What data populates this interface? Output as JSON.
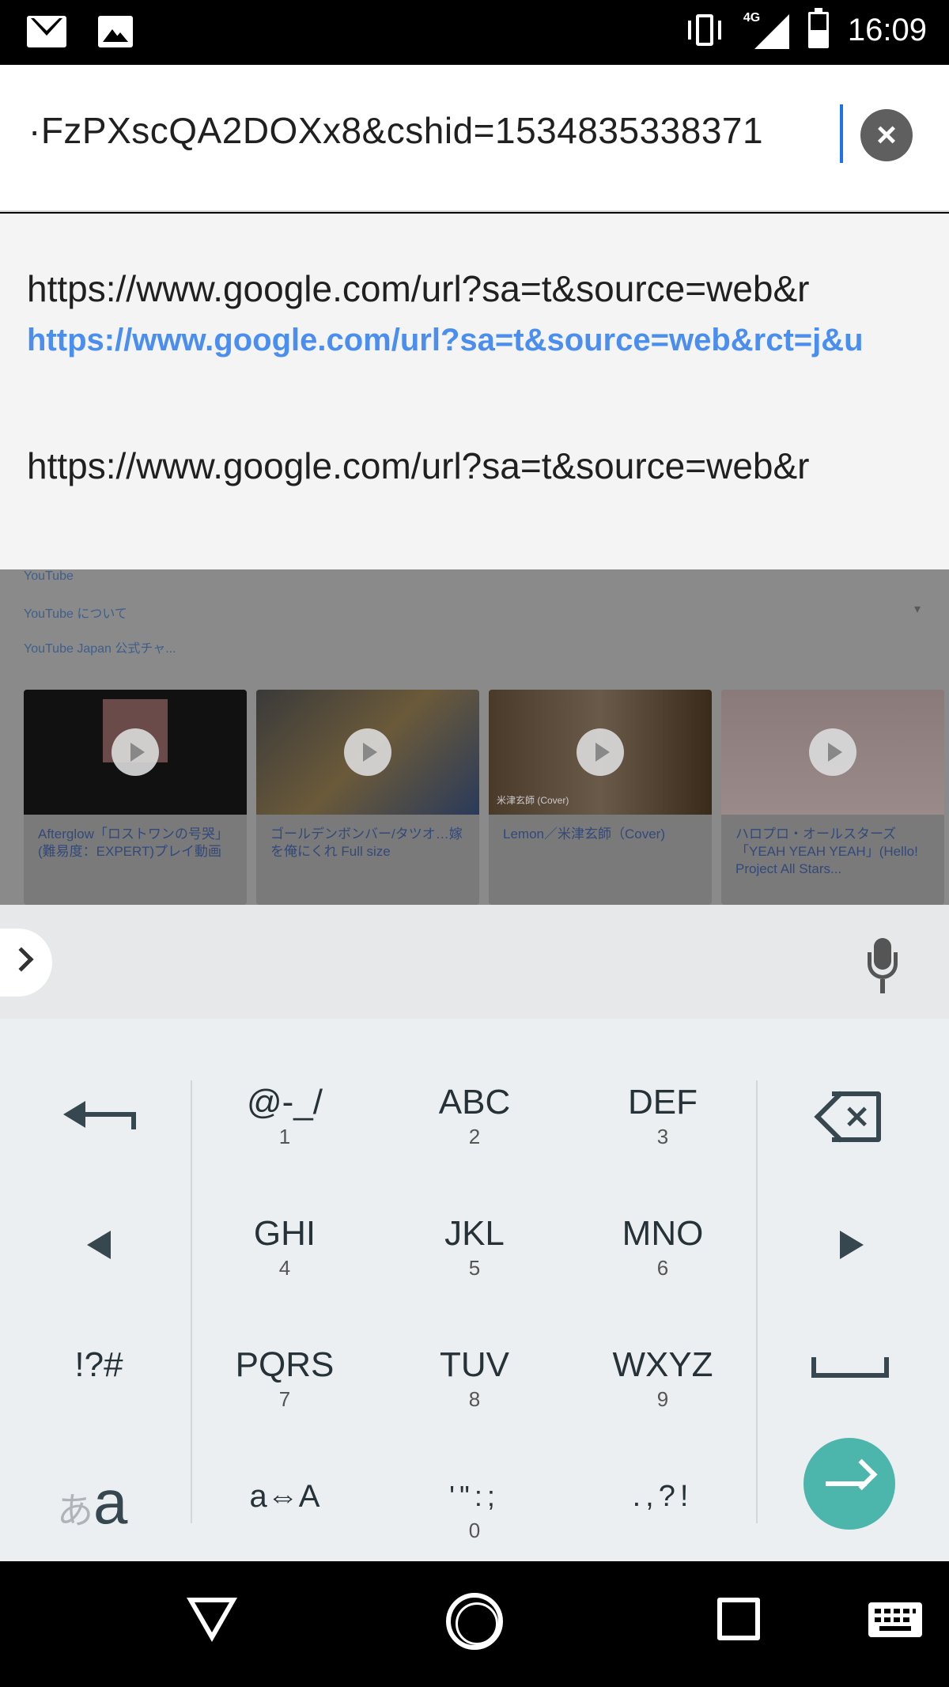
{
  "status_bar": {
    "time": "16:09",
    "network_type": "4G",
    "icons": [
      "gmail-icon",
      "image-icon",
      "vibrate-icon",
      "signal-icon",
      "battery-icon"
    ]
  },
  "url_bar": {
    "value": "·FzPXscQA2DOXx8&cshid=1534835338371",
    "clear_icon": "close-icon"
  },
  "suggestions": [
    {
      "text": "https://www.google.com/url?sa=t&source=web&r",
      "url": "https://www.google.com/url?sa=t&source=web&rct=j&u"
    },
    {
      "text": "https://www.google.com/url?sa=t&source=web&r"
    }
  ],
  "background_page": {
    "links": [
      "YouTube",
      "YouTube について",
      "YouTube Japan 公式チャ..."
    ],
    "videos": [
      {
        "title": "Afterglow「ロストワンの号哭」(難易度：EXPERT)プレイ動画"
      },
      {
        "title": "ゴールデンボンバー/タツオ…嫁を俺にくれ Full size"
      },
      {
        "title": "Lemon／米津玄師（Cover)",
        "thumb_caption": "米津玄師 (Cover)"
      },
      {
        "title": "ハロプロ・オールスターズ「YEAH YEAH YEAH」(Hello! Project All Stars..."
      }
    ]
  },
  "keyboard": {
    "toolbar": {
      "expand_icon": "chevron-right-icon",
      "mic_icon": "mic-icon"
    },
    "keys": {
      "k1": {
        "main": "@-_/",
        "sub": "1"
      },
      "k2": {
        "main": "ABC",
        "sub": "2"
      },
      "k3": {
        "main": "DEF",
        "sub": "3"
      },
      "k4": {
        "main": "GHI",
        "sub": "4"
      },
      "k5": {
        "main": "JKL",
        "sub": "5"
      },
      "k6": {
        "main": "MNO",
        "sub": "6"
      },
      "k7": {
        "main": "PQRS",
        "sub": "7"
      },
      "k8": {
        "main": "TUV",
        "sub": "8"
      },
      "k9": {
        "main": "WXYZ",
        "sub": "9"
      },
      "case": {
        "main": "a⇔A"
      },
      "k0": {
        "main": "'\":;",
        "sub": "0"
      },
      "punct": {
        "main": ".,?!"
      },
      "symbols": {
        "main": "!?#"
      },
      "kana_a": "あ",
      "latin_a": "a"
    },
    "accent_color": "#4db6ac"
  },
  "nav_bar": {
    "icons": [
      "back-icon",
      "home-icon",
      "recents-icon",
      "keyboard-icon"
    ]
  }
}
